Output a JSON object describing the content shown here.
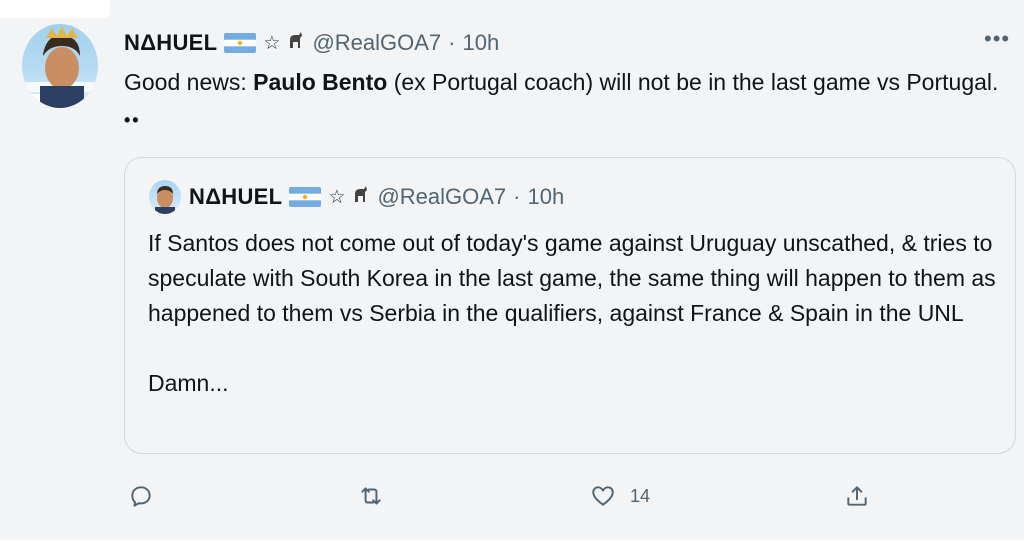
{
  "tweet": {
    "author": {
      "name": "NΔHUEL",
      "handle": "@RealGOA7",
      "separator": "·",
      "time": "10h",
      "badges": [
        "argentina-flag-icon",
        "star-icon",
        "goat-icon"
      ]
    },
    "more_label": "•••",
    "text": {
      "lead": "Good news: ",
      "bold": "Paulo Bento",
      "rest": " (ex Portugal coach) will not be in the last game vs Portugal. ",
      "emoji": "••"
    },
    "quoted": {
      "author": {
        "name": "NΔHUEL",
        "handle": "@RealGOA7",
        "separator": "·",
        "time": "10h"
      },
      "paragraph1": "If Santos does not come out of today's game against Uruguay unscathed, & tries to speculate with South Korea in the last game, the same thing will happen to them as happened to them vs Serbia in the qualifiers, against France & Spain in the UNL",
      "paragraph2": "Damn..."
    },
    "actions": {
      "reply_icon": "reply-icon",
      "retweet_icon": "retweet-icon",
      "like_icon": "heart-icon",
      "like_count": "14",
      "share_icon": "share-icon"
    },
    "colors": {
      "text": "#0f1419",
      "secondary": "#536471",
      "border": "#cfd9de",
      "background": "#f2f4f6",
      "flag_blue": "#74acdf"
    }
  }
}
